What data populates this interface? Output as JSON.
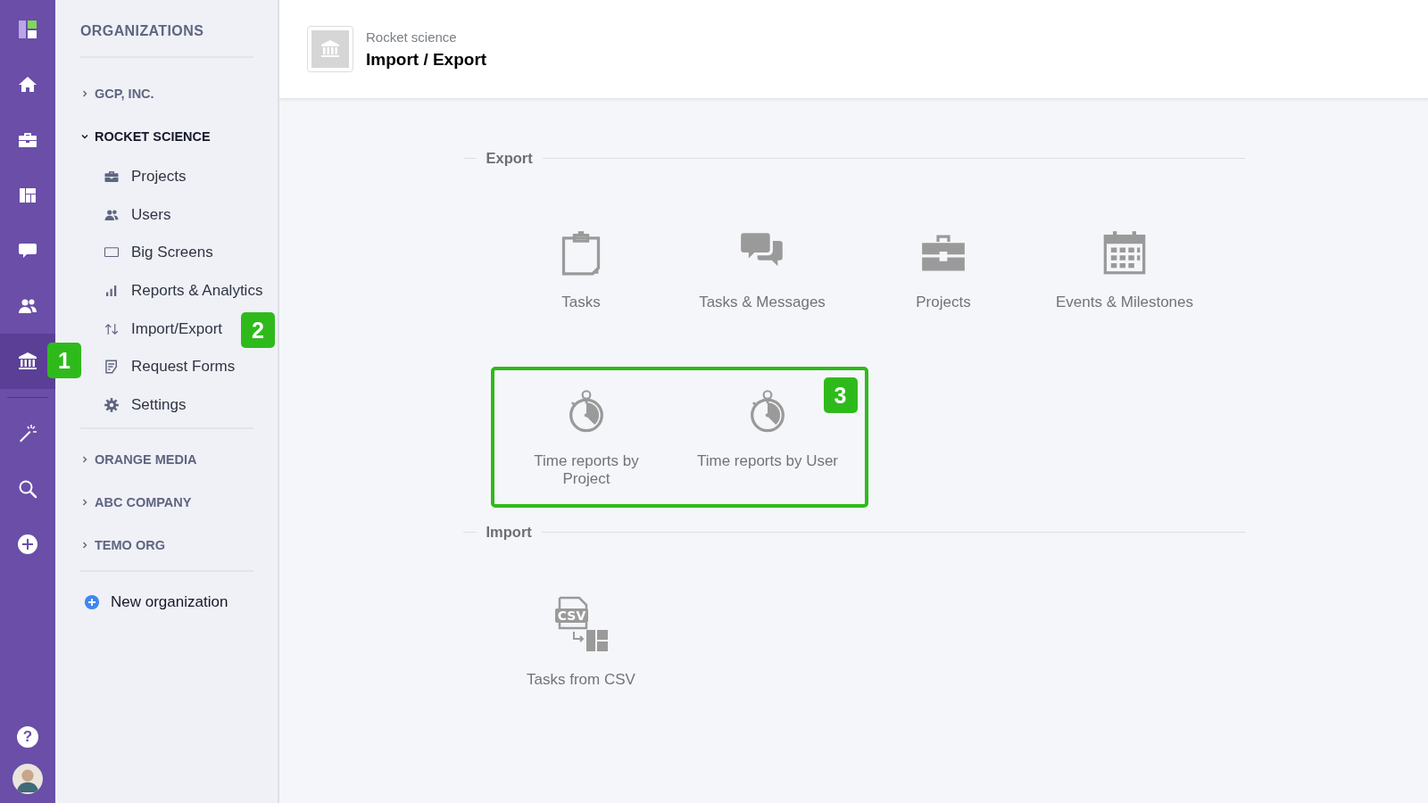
{
  "rail": {
    "items": [
      {
        "kind": "logo",
        "selected": false
      },
      {
        "kind": "home",
        "selected": false
      },
      {
        "kind": "briefcase",
        "selected": false
      },
      {
        "kind": "dashboard",
        "selected": false
      },
      {
        "kind": "chat",
        "selected": false
      },
      {
        "kind": "users",
        "selected": false
      },
      {
        "kind": "bank",
        "selected": true,
        "callout": "1"
      }
    ],
    "tools": [
      {
        "kind": "wand"
      },
      {
        "kind": "search"
      },
      {
        "kind": "plus"
      }
    ],
    "help": "?"
  },
  "sidebar": {
    "title": "ORGANIZATIONS",
    "organizations": [
      {
        "name": "GCP, INC.",
        "expanded": false
      },
      {
        "name": "ROCKET SCIENCE",
        "expanded": true,
        "children": [
          {
            "kind": "briefcase",
            "label": "Projects"
          },
          {
            "kind": "users",
            "label": "Users"
          },
          {
            "kind": "screen",
            "label": "Big Screens"
          },
          {
            "kind": "bars",
            "label": "Reports & Analytics"
          },
          {
            "kind": "arrows",
            "label": "Import/Export",
            "callout": "2"
          },
          {
            "kind": "form",
            "label": "Request Forms"
          },
          {
            "kind": "gear",
            "label": "Settings"
          }
        ]
      },
      {
        "name": "ORANGE MEDIA",
        "expanded": false
      },
      {
        "name": "ABC COMPANY",
        "expanded": false
      },
      {
        "name": "TEMO ORG",
        "expanded": false
      }
    ],
    "new_button": "New organization"
  },
  "header": {
    "org": "Rocket science",
    "title": "Import / Export"
  },
  "sections": [
    {
      "title": "Export",
      "items": [
        {
          "kind": "clipboard",
          "label": "Tasks"
        },
        {
          "kind": "chats",
          "label": "Tasks & Messages"
        },
        {
          "kind": "briefcase",
          "label": "Projects"
        },
        {
          "kind": "calendar",
          "label": "Events & Milestones"
        }
      ],
      "highlight": {
        "callout": "3",
        "items": [
          {
            "kind": "stopwatch",
            "label": "Time reports by Project"
          },
          {
            "kind": "stopwatch",
            "label": "Time reports by User"
          }
        ]
      }
    },
    {
      "title": "Import",
      "items": [
        {
          "kind": "csv",
          "icon_text": "CSV",
          "label": "Tasks from CSV"
        }
      ]
    }
  ]
}
